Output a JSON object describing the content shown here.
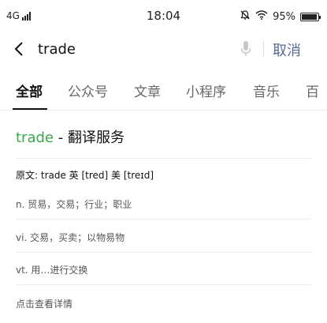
{
  "status_bar": {
    "network": "4G",
    "time": "18:04",
    "battery": "95%",
    "battery_level": 0.95
  },
  "search": {
    "query": "trade",
    "cancel_label": "取消"
  },
  "tabs": [
    {
      "label": "全部"
    },
    {
      "label": "公众号"
    },
    {
      "label": "文章"
    },
    {
      "label": "小程序"
    },
    {
      "label": "音乐"
    },
    {
      "label": "百"
    }
  ],
  "result": {
    "keyword": "trade",
    "title_suffix": " - 翻译服务",
    "origin": "原文: trade   英 [tred]  美 [treɪd]",
    "definitions": [
      "n. 贸易，交易；行业；职业",
      "vi. 交易，买卖；以物易物",
      "vt. 用…进行交换"
    ],
    "detail_link": "点击查看详情"
  },
  "icons": {
    "back": "chevron-left-icon",
    "mic": "microphone-icon",
    "wifi": "wifi-icon",
    "mute": "bell-off-icon",
    "signal": "signal-icon",
    "battery": "battery-icon"
  },
  "colors": {
    "accent_link": "#576b95",
    "keyword_green": "#3aa84b"
  }
}
